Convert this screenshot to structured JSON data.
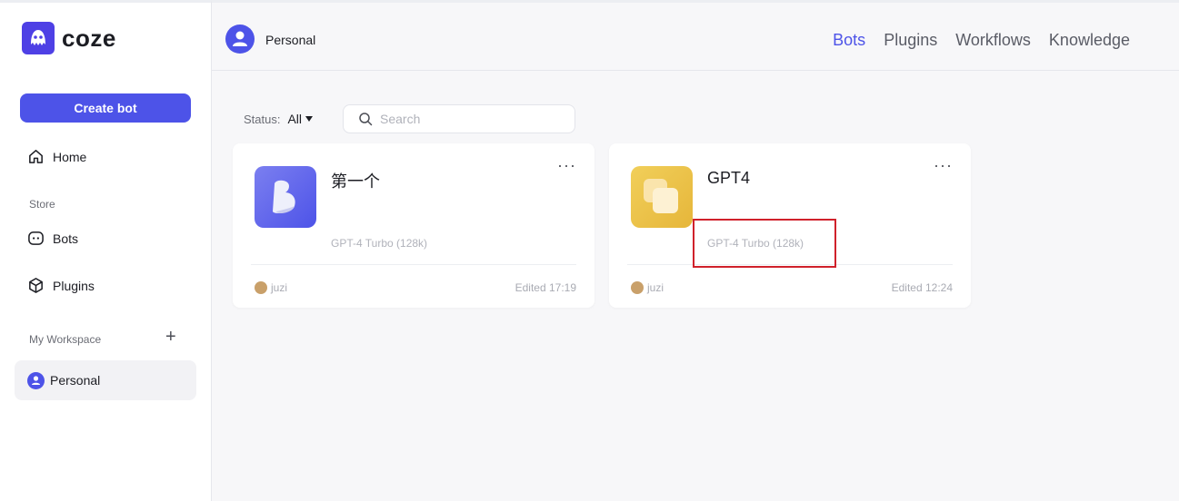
{
  "brand": {
    "name": "coze",
    "color": "#4e40e5"
  },
  "sidebar": {
    "create_label": "Create bot",
    "home_label": "Home",
    "store_label": "Store",
    "bots_label": "Bots",
    "plugins_label": "Plugins",
    "workspace_label": "My Workspace",
    "personal_label": "Personal"
  },
  "header": {
    "title": "Personal",
    "tabs": [
      {
        "label": "Bots",
        "active": true
      },
      {
        "label": "Plugins",
        "active": false
      },
      {
        "label": "Workflows",
        "active": false
      },
      {
        "label": "Knowledge",
        "active": false
      }
    ]
  },
  "filters": {
    "status_label": "Status:",
    "status_value": "All",
    "search_placeholder": "Search"
  },
  "bots": [
    {
      "name": "第一个",
      "model": "GPT-4 Turbo (128k)",
      "user": "juzi",
      "edited": "Edited 17:19"
    },
    {
      "name": "GPT4",
      "model": "GPT-4 Turbo (128k)",
      "user": "juzi",
      "edited": "Edited 12:24"
    }
  ]
}
